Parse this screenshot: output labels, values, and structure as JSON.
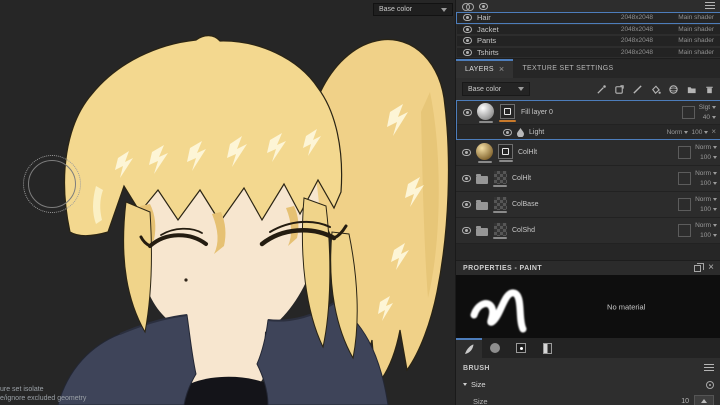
{
  "viewport": {
    "channel_dropdown": "Base color",
    "hints": [
      "ure set isolate",
      "e/ignore excluded geometry"
    ]
  },
  "texture_sets": {
    "rows": [
      {
        "name": "Hair",
        "resolution": "2048x2048",
        "shader": "Main shader",
        "selected": true
      },
      {
        "name": "Jacket",
        "resolution": "2048x2048",
        "shader": "Main shader",
        "selected": false
      },
      {
        "name": "Pants",
        "resolution": "2048x2048",
        "shader": "Main shader",
        "selected": false
      },
      {
        "name": "Tshirts",
        "resolution": "2048x2048",
        "shader": "Main shader",
        "selected": false
      }
    ]
  },
  "layers_panel": {
    "tabs": [
      {
        "label": "LAYERS",
        "active": true
      },
      {
        "label": "TEXTURE SET SETTINGS",
        "active": false
      }
    ],
    "channel_filter": "Base color",
    "layers": [
      {
        "name": "Fill layer 0",
        "blend": "Slgt",
        "opacity": "40",
        "type": "fill",
        "selected": true
      },
      {
        "name": "Light",
        "blend": "Norm",
        "opacity": "100",
        "type": "paint-effect"
      },
      {
        "name": "ColHlt",
        "blend": "Norm",
        "opacity": "100",
        "type": "fill"
      },
      {
        "name": "ColHlt",
        "blend": "Norm",
        "opacity": "100",
        "type": "folder"
      },
      {
        "name": "ColBase",
        "blend": "Norm",
        "opacity": "100",
        "type": "folder"
      },
      {
        "name": "ColShd",
        "blend": "Norm",
        "opacity": "100",
        "type": "folder"
      }
    ]
  },
  "properties": {
    "title": "PROPERTIES - PAINT",
    "no_material": "No material",
    "brush_section": "BRUSH",
    "size_group": "Size",
    "size_label": "Size",
    "size_value": "10"
  },
  "colors": {
    "accent": "#4d7dbb",
    "channel_indicator_orange": "#c97a2b",
    "viewport_bg": "#262626",
    "panel_bg": "#2e2e2e",
    "hair_base": "#f3d88f",
    "hair_highlight": "#fdf5d6",
    "skin": "#f7e6cf",
    "jacket": "#3e4459"
  }
}
